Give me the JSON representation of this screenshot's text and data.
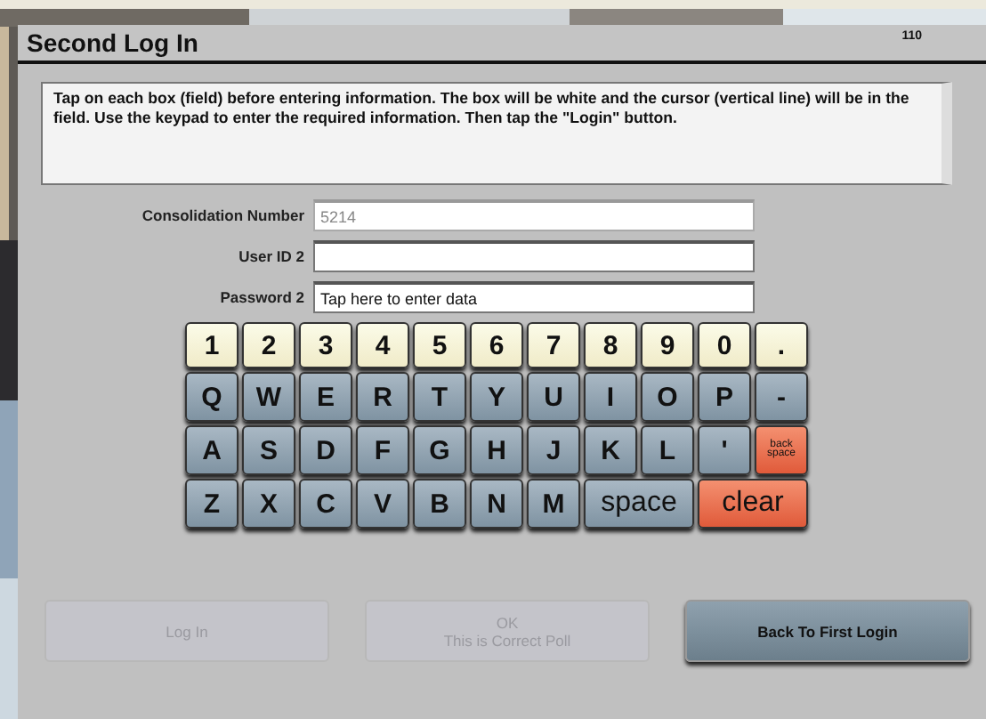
{
  "window": {
    "title": "Second Log In",
    "code": "110"
  },
  "instructions": "Tap on each box (field) before entering information. The box will be white and the cursor (vertical line) will be in the field. Use the keypad to enter the required information. Then tap the \"Login\" button.",
  "fields": [
    {
      "label": "Consolidation Number",
      "value": "5214",
      "disabled": true
    },
    {
      "label": "User ID 2",
      "disabled": false
    },
    {
      "label": "Password 2",
      "value": "Tap here to enter data",
      "disabled": false
    }
  ],
  "keypad": [
    [
      {
        "label": "1",
        "kind": "number"
      },
      {
        "label": "2",
        "kind": "number"
      },
      {
        "label": "3",
        "kind": "number"
      },
      {
        "label": "4",
        "kind": "number"
      },
      {
        "label": "5",
        "kind": "number"
      },
      {
        "label": "6",
        "kind": "number"
      },
      {
        "label": "7",
        "kind": "number"
      },
      {
        "label": "8",
        "kind": "number"
      },
      {
        "label": "9",
        "kind": "number"
      },
      {
        "label": "0",
        "kind": "number"
      },
      {
        "label": ".",
        "kind": "number"
      }
    ],
    [
      {
        "label": "Q",
        "kind": "letter"
      },
      {
        "label": "W",
        "kind": "letter"
      },
      {
        "label": "E",
        "kind": "letter"
      },
      {
        "label": "R",
        "kind": "letter"
      },
      {
        "label": "T",
        "kind": "letter"
      },
      {
        "label": "Y",
        "kind": "letter"
      },
      {
        "label": "U",
        "kind": "letter"
      },
      {
        "label": "I",
        "kind": "letter"
      },
      {
        "label": "O",
        "kind": "letter"
      },
      {
        "label": "P",
        "kind": "letter"
      },
      {
        "label": "-",
        "kind": "letter"
      }
    ],
    [
      {
        "label": "A",
        "kind": "letter"
      },
      {
        "label": "S",
        "kind": "letter"
      },
      {
        "label": "D",
        "kind": "letter"
      },
      {
        "label": "F",
        "kind": "letter"
      },
      {
        "label": "G",
        "kind": "letter"
      },
      {
        "label": "H",
        "kind": "letter"
      },
      {
        "label": "J",
        "kind": "letter"
      },
      {
        "label": "K",
        "kind": "letter"
      },
      {
        "label": "L",
        "kind": "letter"
      },
      {
        "label": "'",
        "kind": "letter"
      },
      {
        "label": "back space",
        "kind": "small-action"
      }
    ],
    [
      {
        "label": "Z",
        "kind": "letter"
      },
      {
        "label": "X",
        "kind": "letter"
      },
      {
        "label": "C",
        "kind": "letter"
      },
      {
        "label": "V",
        "kind": "letter"
      },
      {
        "label": "B",
        "kind": "letter"
      },
      {
        "label": "N",
        "kind": "letter"
      },
      {
        "label": "M",
        "kind": "letter"
      },
      {
        "label": "space",
        "kind": "wide-letter"
      },
      {
        "label": "clear",
        "kind": "wide-action"
      }
    ]
  ],
  "buttons": [
    {
      "label": "Log In",
      "disabled": true
    },
    {
      "label": "OK\nThis is Correct Poll",
      "disabled": true
    },
    {
      "label": "Back To First Login",
      "disabled": false
    }
  ]
}
